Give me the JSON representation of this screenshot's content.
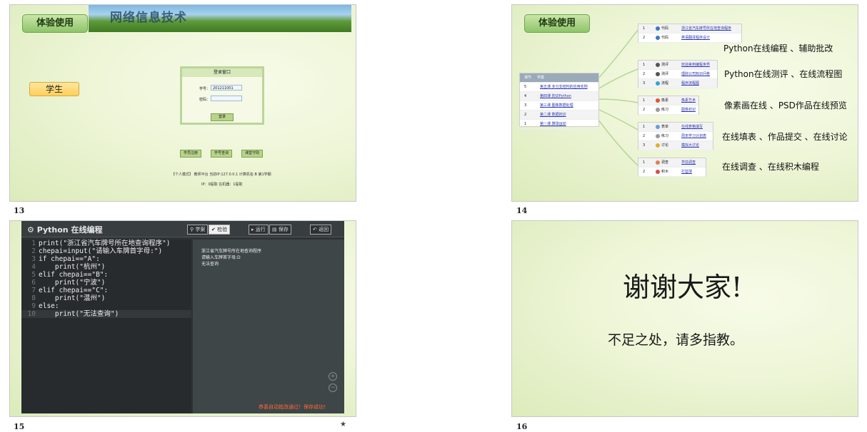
{
  "slides": [
    {
      "number": "13",
      "badge": "体验使用",
      "banner_text": "网络信息技术",
      "role": "学生",
      "login": {
        "title": "登录窗口",
        "id_label": "学号：",
        "id_value": "201211001",
        "pwd_label": "密码：",
        "button": "登录"
      },
      "buttons": [
        "学员注册",
        "学号查询",
        "课堂守则"
      ],
      "footer1": "【个人模式】 教师平台  当前IP:127.0.0.1  计算机名:B 第1学期",
      "footer2": "IP：0提取  在机器：1提取"
    },
    {
      "number": "14",
      "badge": "体验使用",
      "left_table": {
        "headers": [
          "课节",
          "学案"
        ],
        "rows": [
          {
            "n": "5",
            "t": "第五课 多分支结构的应用实例"
          },
          {
            "n": "4",
            "t": "第四课 初识Python"
          },
          {
            "n": "3",
            "t": "第三课 图像数据处理"
          },
          {
            "n": "2",
            "t": "第二课 数据初识"
          },
          {
            "n": "1",
            "t": "第一课 算球运动"
          }
        ]
      },
      "groups": [
        {
          "rows": [
            {
              "n": "1",
              "k": "代码",
              "t": "浙江省汽车牌号所在地查询程序",
              "color": "#3a78c8"
            },
            {
              "n": "2",
              "k": "代码",
              "t": "英语翻译程序设计",
              "color": "#3a78c8"
            }
          ],
          "label": "Python在线编程 、辅助批改"
        },
        {
          "rows": [
            {
              "n": "1",
              "k": "测评",
              "t": "欢迎来到编程世界",
              "color": "#555"
            },
            {
              "n": "2",
              "k": "测评",
              "t": "理财公司知识问卷",
              "color": "#555"
            },
            {
              "n": "3",
              "k": "流程",
              "t": "程序流程图",
              "color": "#3aa0d8"
            }
          ],
          "label": "Python在线测评 、在线流程图"
        },
        {
          "rows": [
            {
              "n": "1",
              "k": "像素",
              "t": "像素艺术",
              "color": "#d85a2a"
            },
            {
              "n": "2",
              "k": "练习",
              "t": "图像初识",
              "color": "#999"
            }
          ],
          "label": "像素画在线 、PSD作品在线预览"
        },
        {
          "rows": [
            {
              "n": "1",
              "k": "表单",
              "t": "在线表格填写",
              "color": "#6aa0d0"
            },
            {
              "n": "2",
              "k": "练习",
              "t": "周末学习计划表",
              "color": "#999"
            },
            {
              "n": "3",
              "k": "讨论",
              "t": "模拟大讨论",
              "color": "#e0b030"
            }
          ],
          "label": "在线填表 、作品提交 、在线讨论"
        },
        {
          "rows": [
            {
              "n": "1",
              "k": "调查",
              "t": "学前调查",
              "color": "#e08050"
            },
            {
              "n": "2",
              "k": "积木",
              "t": "打篮球",
              "color": "#d05050"
            }
          ],
          "label": "在线调查 、在线积木编程"
        }
      ]
    },
    {
      "number": "15",
      "ide": {
        "title": "Python 在线编程",
        "buttons": [
          "学案",
          "检验",
          "运行",
          "保存",
          "返回"
        ],
        "code": [
          "print(\"浙江省汽车牌号所在地查询程序\")",
          "chepai=input(\"请输入车牌首字母:\")",
          "if chepai==\"A\":",
          "    print(\"杭州\")",
          "elif chepai==\"B\":",
          "    print(\"宁波\")",
          "elif chepai==\"C\":",
          "    print(\"温州\")",
          "else:",
          "    print(\"无法查询\")"
        ],
        "output": [
          "浙江省汽车牌号所在地查询程序",
          "请输入车牌首字母:D",
          "无法查询"
        ],
        "status": "恭喜自动批改通过！保存成功！"
      }
    },
    {
      "number": "16",
      "title": "谢谢大家!",
      "subtitle": "不足之处，请多指教。"
    }
  ]
}
